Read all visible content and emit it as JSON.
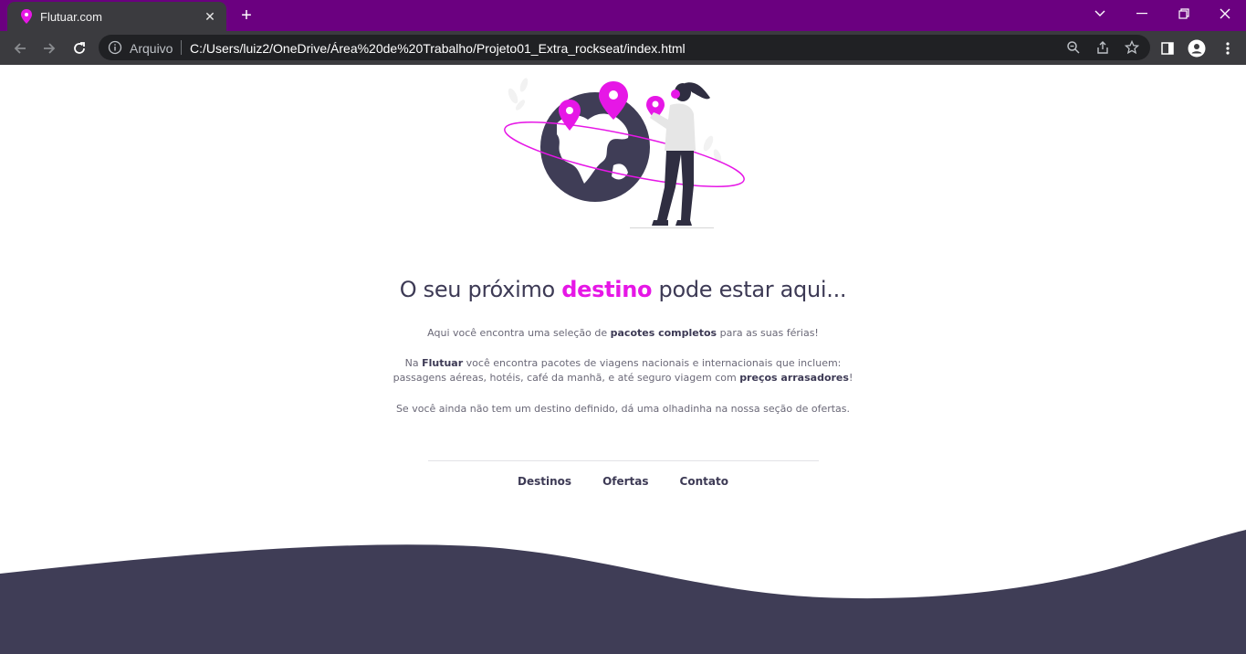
{
  "browser": {
    "tab_title": "Flutuar.com",
    "new_tab": "+",
    "address_scheme": "Arquivo",
    "address_url": "C:/Users/luiz2/OneDrive/Área%20de%20Trabalho/Projeto01_Extra_rockseat/index.html",
    "accent_color": "#6b0080"
  },
  "hero": {
    "headline_before": "O seu próximo",
    "headline_accent": "destino",
    "headline_after": "pode estar aqui..."
  },
  "content": {
    "p1_before": "Aqui você encontra uma seleção de",
    "p1_bold": "pacotes completos",
    "p1_after": "para as suas férias!",
    "p2_line1_before": "Na",
    "p2_line1_bold": "Flutuar",
    "p2_line1_after": "você encontra pacotes de viagens nacionais e internacionais que incluem:",
    "p2_line2_before": "passagens aéreas, hotéis, café da manhã, e até seguro viagem com",
    "p2_line2_bold": "preços arrasadores",
    "p2_line2_after": "!",
    "p3": "Se você ainda não tem um destino definido, dá uma olhadinha na nossa seção de ofertas."
  },
  "nav": {
    "items": [
      "Destinos",
      "Ofertas",
      "Contato"
    ]
  },
  "colors": {
    "accent_pink": "#e617e6",
    "dark": "#3d3a55"
  }
}
